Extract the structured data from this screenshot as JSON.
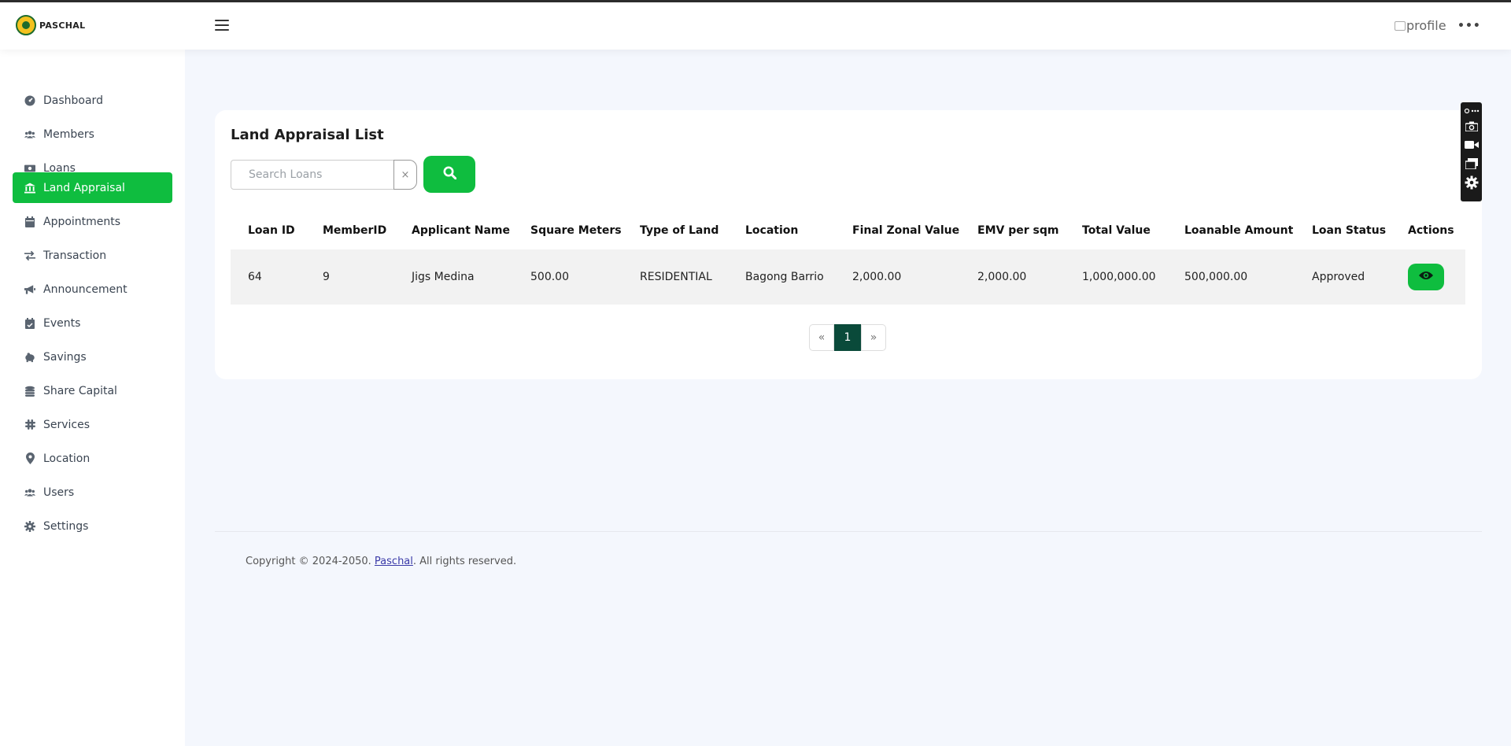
{
  "header": {
    "logo_text": "PASCHAL",
    "profile_alt": "profile",
    "more_label": "•••"
  },
  "sidebar": {
    "items": [
      {
        "label": "Dashboard",
        "icon": "dashboard-icon"
      },
      {
        "label": "Members",
        "icon": "users-icon"
      },
      {
        "label": "Loans",
        "icon": "money-icon"
      },
      {
        "label": "Land Appraisal",
        "icon": "bank-icon",
        "active": true
      },
      {
        "label": "Appointments",
        "icon": "calendar-icon"
      },
      {
        "label": "Transaction",
        "icon": "exchange-icon"
      },
      {
        "label": "Announcement",
        "icon": "megaphone-icon"
      },
      {
        "label": "Events",
        "icon": "calendar-check-icon"
      },
      {
        "label": "Savings",
        "icon": "piggy-bank-icon"
      },
      {
        "label": "Share Capital",
        "icon": "coins-icon"
      },
      {
        "label": "Services",
        "icon": "slack-icon"
      },
      {
        "label": "Location",
        "icon": "map-pin-icon"
      },
      {
        "label": "Users",
        "icon": "users-icon"
      },
      {
        "label": "Settings",
        "icon": "gear-icon"
      }
    ]
  },
  "main": {
    "title": "Land Appraisal List",
    "search": {
      "placeholder": "Search Loans",
      "value": "",
      "clear_label": "×"
    },
    "table": {
      "headers": [
        "Loan ID",
        "MemberID",
        "Applicant Name",
        "Square Meters",
        "Type of Land",
        "Location",
        "Final Zonal Value",
        "EMV per sqm",
        "Total Value",
        "Loanable Amount",
        "Loan Status",
        "Actions"
      ],
      "rows": [
        {
          "loan_id": "64",
          "member_id": "9",
          "applicant": "Jigs Medina",
          "sqm": "500.00",
          "type": "RESIDENTIAL",
          "location": "Bagong Barrio",
          "zonal": "2,000.00",
          "emv": "2,000.00",
          "total": "1,000,000.00",
          "loanable": "500,000.00",
          "status": "Approved"
        }
      ]
    },
    "pagination": {
      "prev": "«",
      "current": "1",
      "next": "»"
    }
  },
  "footer": {
    "prefix": "Copyright © 2024-2050. ",
    "link": "Paschal",
    "suffix": ". All rights reserved."
  },
  "colors": {
    "accent": "#0fbd3f",
    "page_active": "#0a4a3a",
    "background": "#f4f7fd"
  }
}
